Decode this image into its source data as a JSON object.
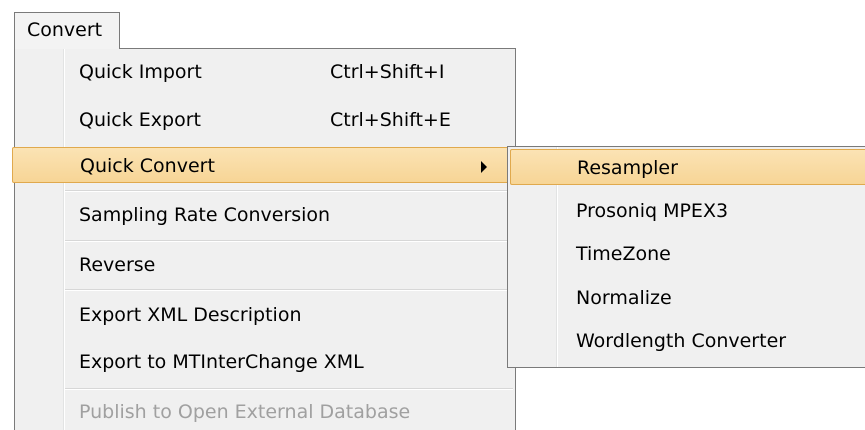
{
  "menubar": {
    "convert_label": "Convert"
  },
  "menu": {
    "items": [
      {
        "label": "Quick Import",
        "shortcut": "Ctrl+Shift+I"
      },
      {
        "label": "Quick Export",
        "shortcut": "Ctrl+Shift+E"
      },
      {
        "label": "Quick Convert",
        "shortcut": ""
      },
      {
        "label": "Sampling Rate Conversion",
        "shortcut": ""
      },
      {
        "label": "Reverse",
        "shortcut": ""
      },
      {
        "label": "Export XML Description",
        "shortcut": ""
      },
      {
        "label": "Export to MTInterChange XML",
        "shortcut": ""
      },
      {
        "label": "Publish to Open External Database",
        "shortcut": ""
      }
    ]
  },
  "submenu": {
    "items": [
      {
        "label": "Resampler"
      },
      {
        "label": "Prosoniq MPEX3"
      },
      {
        "label": "TimeZone"
      },
      {
        "label": "Normalize"
      },
      {
        "label": "Wordlength Converter"
      }
    ]
  },
  "colors": {
    "highlight_top": "#fbe3b4",
    "highlight_bottom": "#f7d596",
    "highlight_border": "#e0a94d",
    "menu_background": "#f0f0f0",
    "disabled_text": "#a0a0a0"
  }
}
